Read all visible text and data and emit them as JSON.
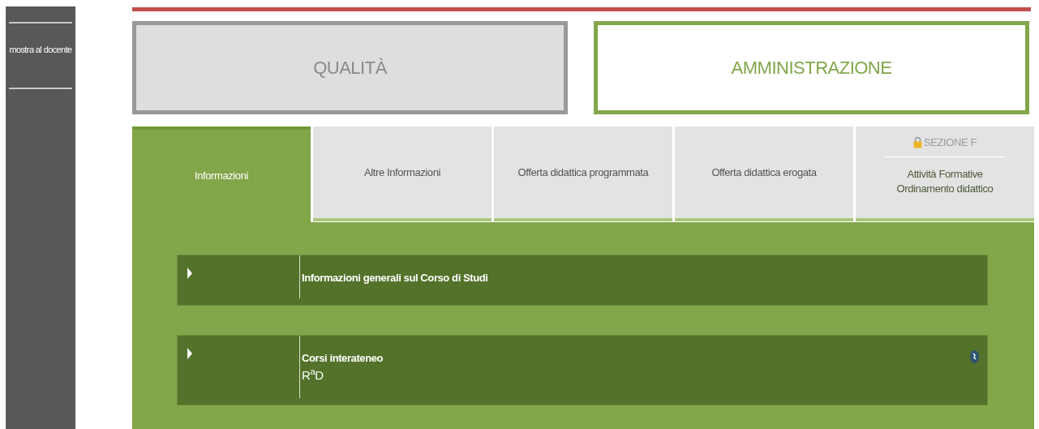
{
  "sidebar": {
    "items": [
      "mostra al docente"
    ]
  },
  "sections": [
    {
      "label": "QUALITÀ",
      "selected": false
    },
    {
      "label": "AMMINISTRAZIONE",
      "selected": true
    }
  ],
  "tabs": [
    {
      "kind": "plain",
      "label": "Informazioni",
      "selected": true
    },
    {
      "kind": "plain",
      "label": "Altre Informazioni",
      "selected": false
    },
    {
      "kind": "plain",
      "label": "Offerta didattica programmata",
      "selected": false
    },
    {
      "kind": "plain",
      "label": "Offerta didattica erogata",
      "selected": false
    },
    {
      "kind": "locked",
      "lock_label": "SEZIONE F",
      "lines": [
        "Attività Formative",
        "Ordinamento didattico"
      ],
      "selected": false
    }
  ],
  "accordion": [
    {
      "title": "Informazioni generali sul Corso di Studi",
      "expanded": false,
      "badge": false
    },
    {
      "title": "Corsi interateneo",
      "subtitle": "R$^{a}$D",
      "expanded": false,
      "badge": true
    }
  ]
}
